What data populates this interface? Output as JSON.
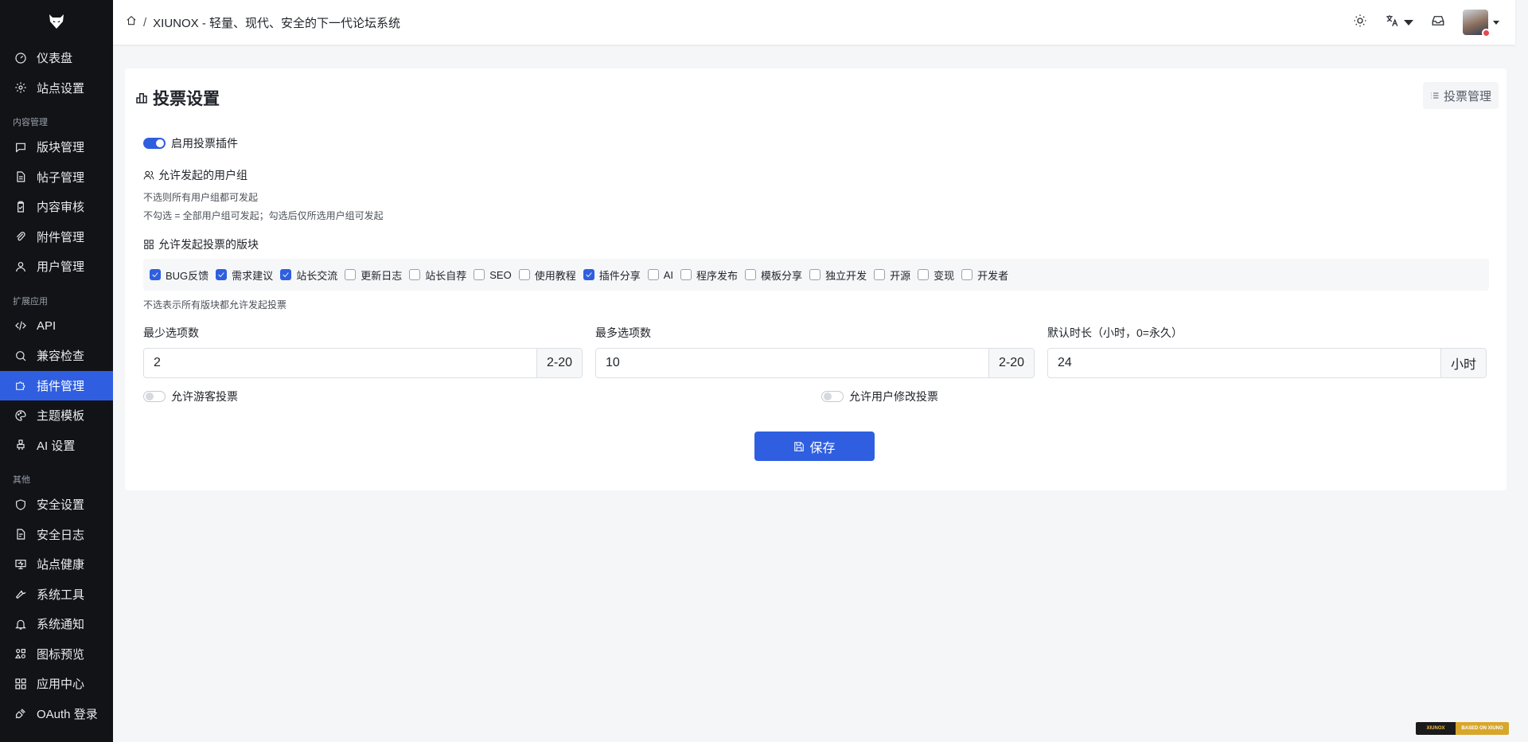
{
  "sidebar": {
    "top_items": [
      {
        "label": "仪表盘",
        "icon": "dashboard-icon"
      },
      {
        "label": "站点设置",
        "icon": "gear-icon"
      }
    ],
    "sections": [
      {
        "title": "内容管理",
        "items": [
          {
            "label": "版块管理",
            "icon": "chat-icon"
          },
          {
            "label": "帖子管理",
            "icon": "document-icon"
          },
          {
            "label": "内容审核",
            "icon": "clipboard-check-icon"
          },
          {
            "label": "附件管理",
            "icon": "paperclip-icon"
          },
          {
            "label": "用户管理",
            "icon": "user-icon"
          }
        ]
      },
      {
        "title": "扩展应用",
        "items": [
          {
            "label": "API",
            "icon": "code-icon"
          },
          {
            "label": "兼容检查",
            "icon": "search-icon"
          },
          {
            "label": "插件管理",
            "icon": "puzzle-icon",
            "active": true
          },
          {
            "label": "主题模板",
            "icon": "palette-icon"
          },
          {
            "label": "AI 设置",
            "icon": "ai-icon"
          }
        ]
      },
      {
        "title": "其他",
        "items": [
          {
            "label": "安全设置",
            "icon": "shield-icon"
          },
          {
            "label": "安全日志",
            "icon": "log-icon"
          },
          {
            "label": "站点健康",
            "icon": "monitor-icon"
          },
          {
            "label": "系统工具",
            "icon": "wrench-icon"
          },
          {
            "label": "系统通知",
            "icon": "bell-icon"
          },
          {
            "label": "图标预览",
            "icon": "shapes-icon"
          },
          {
            "label": "应用中心",
            "icon": "apps-icon"
          },
          {
            "label": "OAuth 登录",
            "icon": "plug-icon"
          }
        ]
      }
    ]
  },
  "header": {
    "breadcrumb_sep": "/",
    "title": "XIUNOX - 轻量、现代、安全的下一代论坛系统"
  },
  "page": {
    "title": "投票设置",
    "manage_button": "投票管理",
    "enable_label": "启用投票插件",
    "enable_on": true,
    "groups_title": "允许发起的用户组",
    "groups_hint1": "不选则所有用户组都可发起",
    "groups_hint2": "不勾选 = 全部用户组可发起；勾选后仅所选用户组可发起",
    "boards_title": "允许发起投票的版块",
    "boards": [
      {
        "label": "BUG反馈",
        "checked": true
      },
      {
        "label": "需求建议",
        "checked": true
      },
      {
        "label": "站长交流",
        "checked": true
      },
      {
        "label": "更新日志",
        "checked": false
      },
      {
        "label": "站长自荐",
        "checked": false
      },
      {
        "label": "SEO",
        "checked": false
      },
      {
        "label": "使用教程",
        "checked": false
      },
      {
        "label": "插件分享",
        "checked": true
      },
      {
        "label": "AI",
        "checked": false
      },
      {
        "label": "程序发布",
        "checked": false
      },
      {
        "label": "模板分享",
        "checked": false
      },
      {
        "label": "独立开发",
        "checked": false
      },
      {
        "label": "开源",
        "checked": false
      },
      {
        "label": "变现",
        "checked": false
      },
      {
        "label": "开发者",
        "checked": false
      }
    ],
    "boards_hint": "不选表示所有版块都允许发起投票",
    "min_label": "最少选项数",
    "min_value": "2",
    "min_suffix": "2-20",
    "max_label": "最多选项数",
    "max_value": "10",
    "max_suffix": "2-20",
    "duration_label": "默认时长（小时，0=永久）",
    "duration_value": "24",
    "duration_suffix": "小时",
    "guest_label": "允许游客投票",
    "guest_on": false,
    "modify_label": "允许用户修改投票",
    "modify_on": false,
    "save_label": "保存"
  },
  "footer_badge": {
    "left": "XIUNOX",
    "right": "BASED ON XIUNO"
  },
  "colors": {
    "accent": "#2f5fe0",
    "sidebar_bg": "#111317"
  }
}
